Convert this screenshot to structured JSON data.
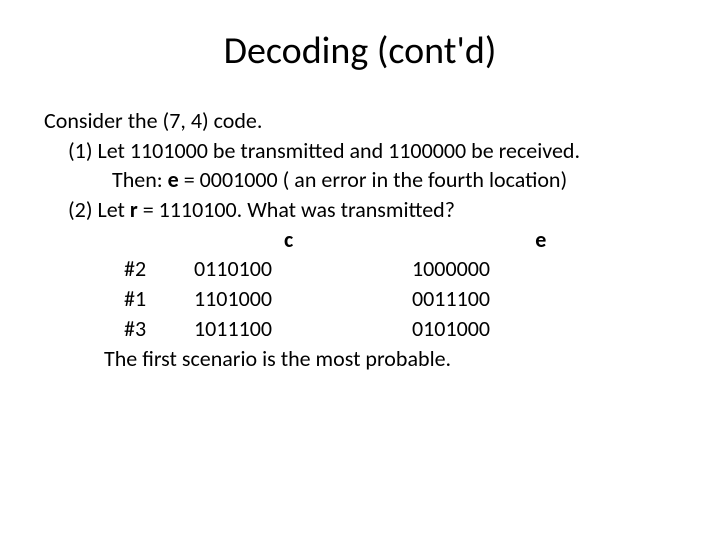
{
  "title": "Decoding (cont'd)",
  "intro": "Consider the (7, 4) code.",
  "point1_prefix": "(1) Let  1101000 be transmitted and 1100000 be received.",
  "then_prefix": "Then: ",
  "e_label": "e",
  "then_suffix": " = 0001000 ( an error in the fourth location)",
  "point2_prefix": "(2) Let ",
  "r_label": "r",
  "point2_suffix": " = 1110100. What was transmitted?",
  "header_c": "c",
  "header_e": "e",
  "rows": [
    {
      "idx": "#2",
      "c": "0110100",
      "e": "1000000"
    },
    {
      "idx": "#1",
      "c": "1101000",
      "e": "0011100"
    },
    {
      "idx": "#3",
      "c": "1011100",
      "e": "0101000"
    }
  ],
  "conclusion": "The first scenario is the most probable."
}
